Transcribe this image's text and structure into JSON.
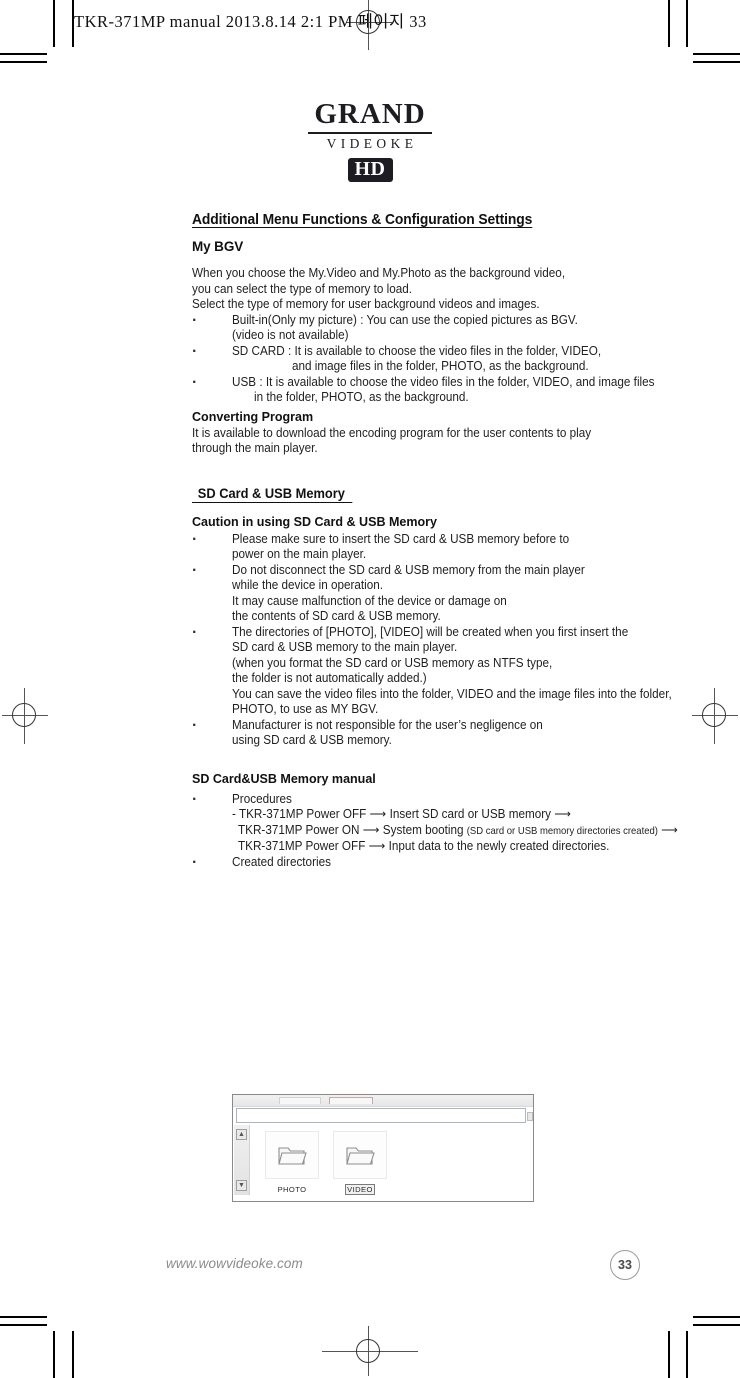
{
  "print_slug": "TKR-371MP manual  2013.8.14  2:1 PM 페이지 33",
  "logo": {
    "brand": "GRAND",
    "sub": "VIDEOKE",
    "badge": "HD"
  },
  "content": {
    "title": "Additional Menu Functions & Configuration Settings",
    "my_bgv": {
      "heading": "My BGV",
      "intro": [
        "When you choose the My.Video and My.Photo as the background video,",
        "you can select the type of memory to load.",
        "Select the type of memory for user background videos and images."
      ],
      "bullets": [
        {
          "lines": [
            "Built-in(Only my picture) : You can use the copied pictures as BGV.",
            "(video is not available)"
          ]
        },
        {
          "lines": [
            "SD CARD : It is available to choose the video files in the folder, VIDEO,",
            "and image files in the folder, PHOTO, as the background."
          ]
        },
        {
          "lines": [
            "USB : It is available to choose the video files in the folder, VIDEO, and image files",
            "in the folder, PHOTO, as the background."
          ]
        }
      ]
    },
    "converting_program": {
      "heading": "Converting Program",
      "lines": [
        "It is available to download the encoding program for the user contents to play",
        "through the main player."
      ]
    },
    "sd_section": {
      "heading": "SD Card & USB Memory ",
      "caution_heading": "Caution in using SD Card & USB Memory",
      "caution_bullets": [
        {
          "lines": [
            "Please make sure to insert the SD card & USB memory before to",
            "power on the main player."
          ]
        },
        {
          "lines": [
            "Do not disconnect the SD card & USB memory from the main player",
            "while the device in operation.",
            "It may cause malfunction of the device or damage on",
            "the contents of SD card & USB memory."
          ]
        },
        {
          "lines": [
            "The directories of  [PHOTO], [VIDEO] will be created when you first insert the",
            "SD card & USB memory to the main player.",
            "(when you format the SD card or USB memory as NTFS type,",
            "the folder is not automatically added.)",
            "You can save the video files into the folder, VIDEO and the image files into the folder,",
            "PHOTO, to use as MY BGV."
          ]
        },
        {
          "lines": [
            "Manufacturer is not responsible for the user’s negligence on",
            "using SD card & USB memory."
          ]
        }
      ]
    },
    "manual_section": {
      "heading": "SD Card&USB Memory manual",
      "procedures_label": "Procedures",
      "procedure_lines": [
        "- TKR-371MP Power OFF ⟶ Insert SD card or USB memory ⟶",
        "TKR-371MP Power ON ⟶ System booting ",
        "(SD card or USB memory directories created)",
        " ⟶",
        "TKR-371MP Power OFF ⟶ Input data to the newly created directories."
      ],
      "created_dirs_label": "Created directories"
    }
  },
  "screenshot": {
    "folders": [
      {
        "label": "PHOTO",
        "selected": false
      },
      {
        "label": "VIDEO",
        "selected": true
      }
    ]
  },
  "footer": {
    "url": "www.wowvideoke.com",
    "page_number": "33"
  }
}
